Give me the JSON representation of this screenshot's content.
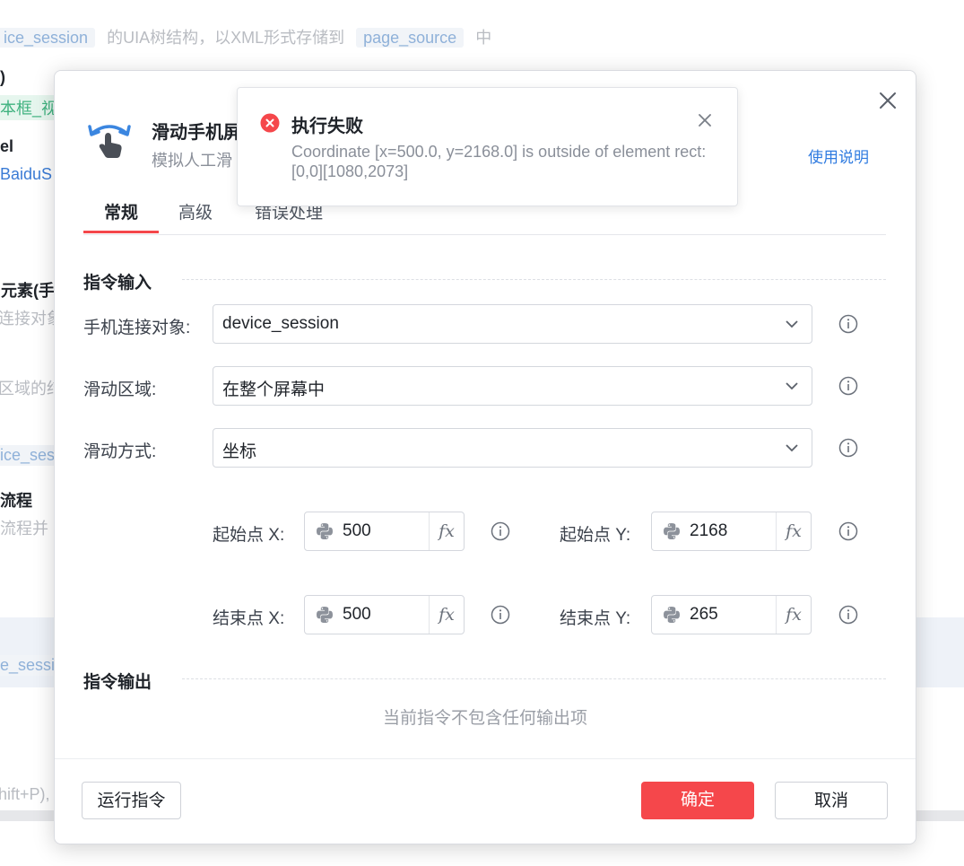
{
  "background": {
    "line1_code1": "ice_session",
    "line1_text": "的UIA树结构，以XML形式存储到",
    "line1_code2": "page_source",
    "line1_end": "中",
    "paren": ")",
    "green_tag": "本框_视",
    "el_label": "el",
    "baidu": "BaiduS",
    "element_title": "l元素(手",
    "conn_obj": "连接对象",
    "region_text": "区域的结",
    "session2": "ice_sess",
    "flow_title": "流程",
    "flow_desc": "流程并",
    "session3": "e_sessio",
    "shortcut": "hift+P),"
  },
  "dialog": {
    "title": "滑动手机屏",
    "subtitle": "模拟人工滑",
    "help_link": "使用说明",
    "tabs": [
      {
        "label": "常规",
        "active": true
      },
      {
        "label": "高级",
        "active": false
      },
      {
        "label": "错误处理",
        "active": false
      }
    ],
    "input_section": "指令输入",
    "fields": {
      "connection": {
        "label": "手机连接对象:",
        "value": "device_session"
      },
      "region": {
        "label": "滑动区域:",
        "value": "在整个屏幕中"
      },
      "method": {
        "label": "滑动方式:",
        "value": "坐标"
      }
    },
    "coords": {
      "start_x": {
        "label": "起始点 X:",
        "value": "500"
      },
      "start_y": {
        "label": "起始点 Y:",
        "value": "2168"
      },
      "end_x": {
        "label": "结束点 X:",
        "value": "500"
      },
      "end_y": {
        "label": "结束点 Y:",
        "value": "265"
      }
    },
    "fx_label": "fx",
    "output_section": "指令输出",
    "output_empty": "当前指令不包含任何输出项",
    "buttons": {
      "run": "运行指令",
      "ok": "确定",
      "cancel": "取消"
    }
  },
  "toast": {
    "title": "执行失败",
    "message": "Coordinate [x=500.0, y=2168.0] is outside of element rect: [0,0][1080,2073]"
  },
  "colors": {
    "accent_red": "#f5474b",
    "link_blue": "#2f7be0",
    "error_red": "#f5474b"
  },
  "icons": [
    "swipe-hand-icon",
    "close-icon",
    "chevron-down-icon",
    "info-icon",
    "python-icon",
    "error-circle-icon"
  ]
}
